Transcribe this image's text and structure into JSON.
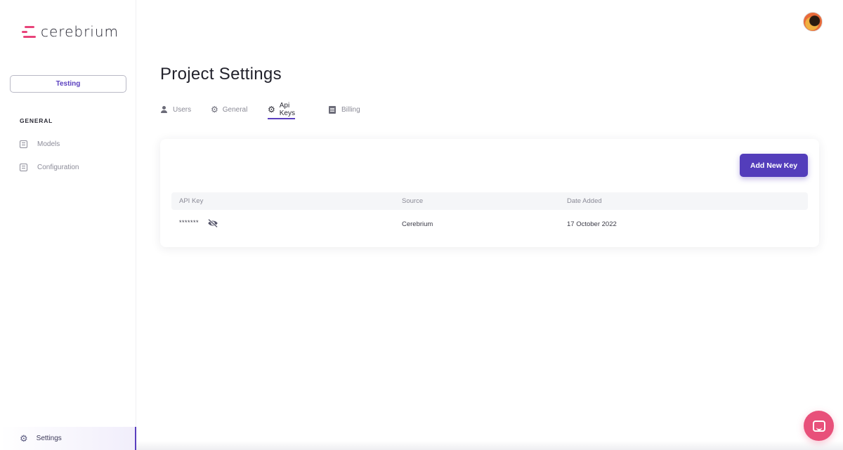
{
  "brand": {
    "name": "cerebrium",
    "accent": "#e8447a",
    "primary": "#533dbb"
  },
  "sidebar": {
    "project": "Testing",
    "section_label": "GENERAL",
    "items": [
      {
        "label": "Models",
        "icon": "table-icon"
      },
      {
        "label": "Configuration",
        "icon": "table-icon"
      }
    ],
    "footer_item": {
      "label": "Settings",
      "icon": "gear-icon"
    }
  },
  "main": {
    "title": "Project Settings",
    "tabs": [
      {
        "label": "Users",
        "icon": "user-icon"
      },
      {
        "label": "General",
        "icon": "gear-icon"
      },
      {
        "label": "Api Keys",
        "icon": "gear-icon",
        "active": true
      },
      {
        "label": "Billing",
        "icon": "document-icon"
      }
    ],
    "card": {
      "add_button": "Add New Key",
      "columns": [
        "API Key",
        "Source",
        "Date Added"
      ],
      "rows": [
        {
          "key": "*******",
          "source": "Cerebrium",
          "date": "17 October 2022"
        }
      ]
    }
  }
}
